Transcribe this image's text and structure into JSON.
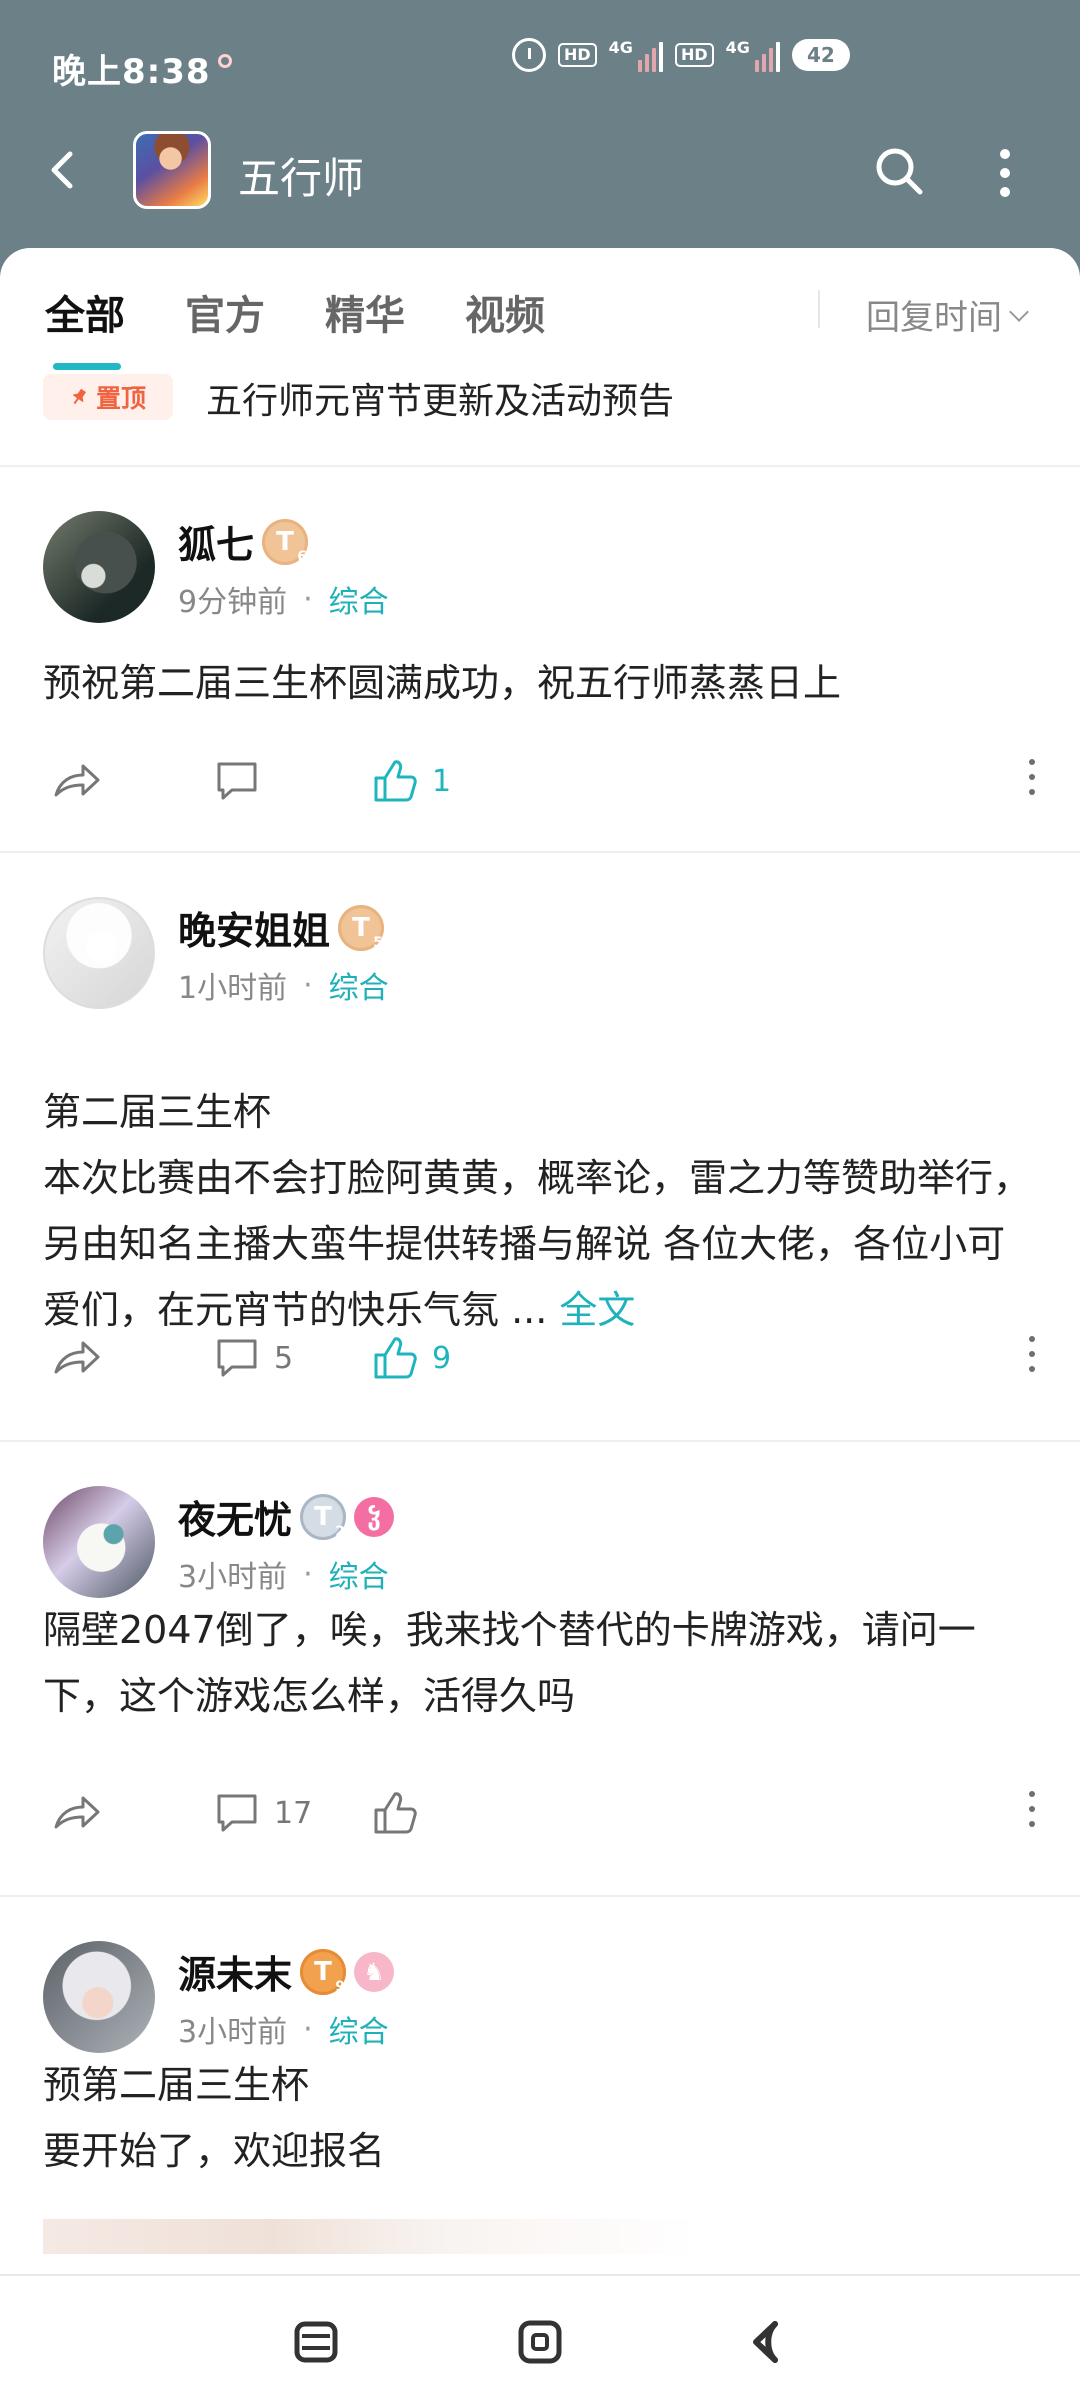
{
  "status": {
    "time": "晚上8:38",
    "network_1_label": "4G",
    "network_2_label": "4G",
    "hd_1": "HD",
    "hd_2": "HD",
    "battery": "42"
  },
  "header": {
    "title": "五行师"
  },
  "tabs": [
    {
      "label": "全部",
      "active": true
    },
    {
      "label": "官方",
      "active": false
    },
    {
      "label": "精华",
      "active": false
    },
    {
      "label": "视频",
      "active": false
    }
  ],
  "sort": {
    "label": "回复时间"
  },
  "pinned": {
    "badge": "置顶",
    "title": "五行师元宵节更新及活动预告"
  },
  "posts": [
    {
      "author": "狐七",
      "level": "T",
      "level_num": "6",
      "time": "9分钟前",
      "separator": "·",
      "category": "综合",
      "content": "预祝第二届三生杯圆满成功，祝五行师蒸蒸日上",
      "comments": "",
      "likes": "1"
    },
    {
      "author": "晚安姐姐",
      "level": "T",
      "level_num": "5",
      "time": "1小时前",
      "separator": "·",
      "category": "综合",
      "content": "第二届三生杯\n本次比赛由不会打脸阿黄黄，概率论，雷之力等赞助举行，另由知名主播大蛮牛提供转播与解说 各位大佬，各位小可爱们，在元宵节的快乐气氛 ... ",
      "full_text": "全文",
      "comments": "5",
      "likes": "9"
    },
    {
      "author": "夜无忧",
      "level": "T",
      "level_num": "2",
      "extra_badge": "ჴ",
      "time": "3小时前",
      "separator": "·",
      "category": "综合",
      "content": "隔壁2047倒了，唉，我来找个替代的卡牌游戏，请问一下，这个游戏怎么样，活得久吗",
      "comments": "17",
      "likes": ""
    },
    {
      "author": "源未末",
      "level": "T",
      "level_num": "9",
      "extra_badge": "♞",
      "time": "3小时前",
      "separator": "·",
      "category": "综合",
      "content": "预第二届三生杯\n要开始了，欢迎报名"
    }
  ],
  "colors": {
    "header": "#6c8088",
    "accent": "#1eb5be",
    "pin": "#f06441"
  },
  "icons": {
    "back": "back-icon",
    "search": "search-icon",
    "more": "more-icon",
    "share": "share-icon",
    "comment": "comment-icon",
    "like": "like-icon",
    "menu": "menu-icon",
    "home": "home-icon",
    "return": "return-icon"
  }
}
